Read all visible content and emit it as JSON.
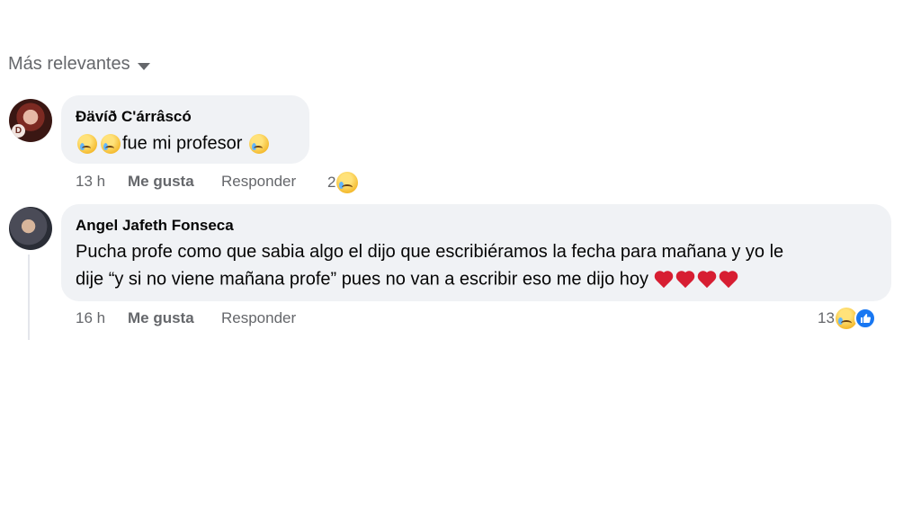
{
  "sort": {
    "label": "Más relevantes"
  },
  "comments": [
    {
      "author": "Ðävíð C'árrâscó",
      "avatar_initial": "D",
      "text": "fue mi profesor",
      "time": "13 h",
      "like_label": "Me gusta",
      "reply_label": "Responder",
      "reaction_count": "2"
    },
    {
      "author": "Angel Jafeth Fonseca",
      "text_line1": "Pucha profe como que sabia algo el dijo que escribiéramos la fecha para mañana y yo le",
      "text_line2": "dije “y si no viene mañana profe” pues no van a escribir eso me dijo hoy",
      "time": "16 h",
      "like_label": "Me gusta",
      "reply_label": "Responder",
      "reaction_count": "13"
    }
  ]
}
